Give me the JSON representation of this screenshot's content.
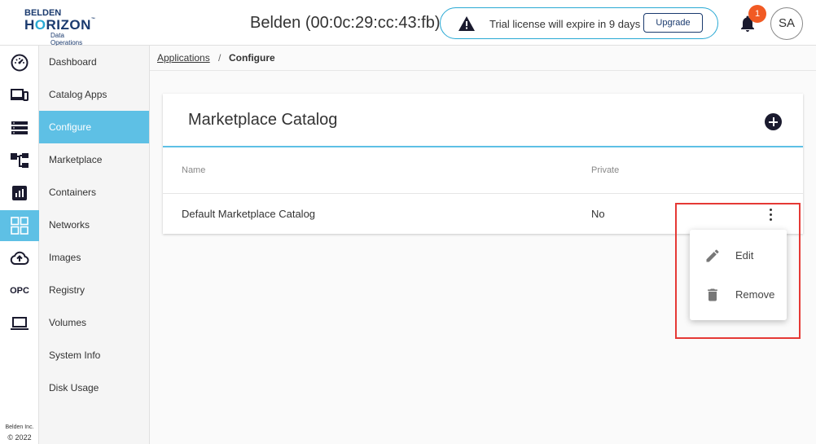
{
  "header": {
    "logo": {
      "line1": "BELDEN",
      "line2a": "H",
      "line2b": "O",
      "line2c": "RIZON",
      "tm": "™",
      "line3": "Data Operations"
    },
    "device_title": "Belden (00:0c:29:cc:43:fb)",
    "trial": {
      "message": "Trial license will expire in 9 days",
      "upgrade_label": "Upgrade"
    },
    "notification_count": "1",
    "user_initials": "SA"
  },
  "rail": {
    "icons": [
      "dashboard-gauge-icon",
      "devices-icon",
      "list-icon",
      "hierarchy-icon",
      "chart-icon",
      "apps-grid-icon",
      "cloud-upload-icon",
      "opc-icon",
      "laptop-icon"
    ],
    "opc_label": "OPC",
    "copyright_line1": "Belden Inc.",
    "copyright_line2": "© 2022"
  },
  "menu": {
    "items": [
      {
        "label": "Dashboard"
      },
      {
        "label": "Catalog Apps"
      },
      {
        "label": "Configure"
      },
      {
        "label": "Marketplace"
      },
      {
        "label": "Containers"
      },
      {
        "label": "Networks"
      },
      {
        "label": "Images"
      },
      {
        "label": "Registry"
      },
      {
        "label": "Volumes"
      },
      {
        "label": "System Info"
      },
      {
        "label": "Disk Usage"
      }
    ],
    "active": "Configure"
  },
  "breadcrumb": {
    "link": "Applications",
    "separator": "/",
    "current": "Configure"
  },
  "card": {
    "title": "Marketplace Catalog",
    "columns": [
      "Name",
      "Private"
    ],
    "rows": [
      {
        "name": "Default Marketplace Catalog",
        "private": "No"
      }
    ]
  },
  "context_menu": {
    "items": [
      {
        "label": "Edit",
        "icon": "pencil-icon"
      },
      {
        "label": "Remove",
        "icon": "trash-icon"
      }
    ]
  },
  "colors": {
    "accent": "#5ec0e5",
    "brand": "#1a3a6e",
    "badge": "#f15a24",
    "highlight": "#e53935"
  }
}
